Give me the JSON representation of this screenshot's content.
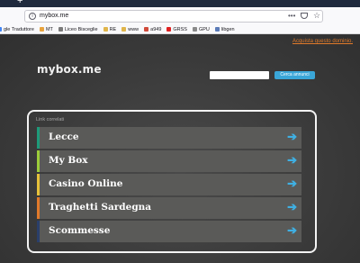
{
  "browser": {
    "new_tab": "+",
    "url": "mybox.me",
    "page_actions": "•••",
    "star": "☆",
    "bookmarks": [
      {
        "label": "gle Traduttore",
        "color": "#4285f4"
      },
      {
        "label": "MT",
        "color": "#e8a33d"
      },
      {
        "label": "Liceo Bisceglie",
        "color": "#7a7a7a"
      },
      {
        "label": "RE",
        "color": "#e0b54a"
      },
      {
        "label": "www",
        "color": "#e0b54a"
      },
      {
        "label": "a949",
        "color": "#d04a3a"
      },
      {
        "label": "GRSS",
        "color": "#e02020"
      },
      {
        "label": "GPU",
        "color": "#8a8a8a"
      },
      {
        "label": "libgen",
        "color": "#5b7bb8"
      }
    ]
  },
  "page": {
    "buy_link": "Acquista questo dominio.",
    "logo": "mybox.me",
    "search_button": "Cerca annunci",
    "section_label": "Link correlati",
    "links": [
      {
        "label": "Lecce",
        "accent": "#1e9a7a"
      },
      {
        "label": "My Box",
        "accent": "#9ccc3a"
      },
      {
        "label": "Casino Online",
        "accent": "#e6c13a"
      },
      {
        "label": "Traghetti Sardegna",
        "accent": "#e0792a"
      },
      {
        "label": "Scommesse",
        "accent": "#2a3f6b"
      }
    ],
    "arrow": "➔"
  }
}
